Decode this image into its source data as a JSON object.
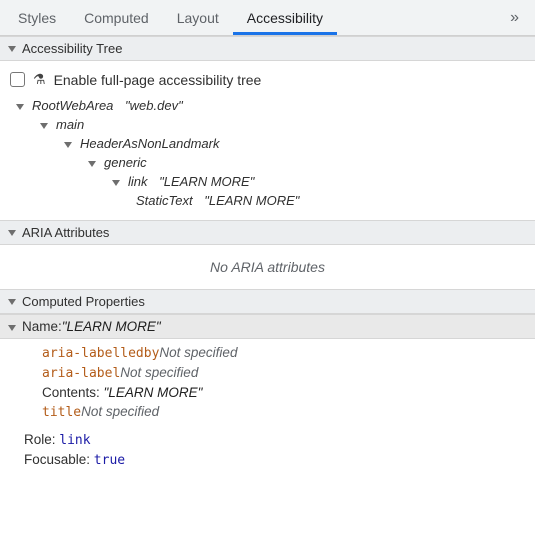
{
  "tabs": {
    "styles": "Styles",
    "computed": "Computed",
    "layout": "Layout",
    "accessibility": "Accessibility"
  },
  "sections": {
    "a11y_tree": "Accessibility Tree",
    "aria_attrs": "ARIA Attributes",
    "computed_props": "Computed Properties"
  },
  "enable": {
    "label": "Enable full-page accessibility tree"
  },
  "tree": {
    "n0_role": "RootWebArea",
    "n0_name": "\"web.dev\"",
    "n1_role": "main",
    "n2_role": "HeaderAsNonLandmark",
    "n3_role": "generic",
    "n4_role": "link",
    "n4_name": "\"LEARN MORE\"",
    "n5_role": "StaticText",
    "n5_name": "\"LEARN MORE\""
  },
  "aria": {
    "empty": "No ARIA attributes"
  },
  "computed": {
    "name_label": "Name: ",
    "name_value": "\"LEARN MORE\"",
    "aria_labelledby": "aria-labelledby",
    "aria_label": "aria-label",
    "contents_label": "Contents: ",
    "contents_value": "\"LEARN MORE\"",
    "title_attr": "title",
    "not_specified": "Not specified",
    "role_label": "Role: ",
    "role_value": "link",
    "focusable_label": "Focusable: ",
    "focusable_value": "true"
  },
  "sep": ": "
}
